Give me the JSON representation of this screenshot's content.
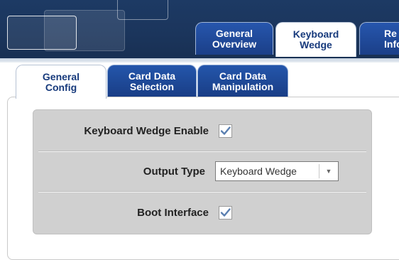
{
  "top_tabs": [
    {
      "label_line1": "General",
      "label_line2": "Overview",
      "active": false
    },
    {
      "label_line1": "Keyboard",
      "label_line2": "Wedge",
      "active": true
    },
    {
      "label_line1": "Re",
      "label_line2": "Infor",
      "active": false
    }
  ],
  "sub_tabs": [
    {
      "label_line1": "General",
      "label_line2": "Config",
      "active": true
    },
    {
      "label_line1": "Card Data",
      "label_line2": "Selection",
      "active": false
    },
    {
      "label_line1": "Card Data",
      "label_line2": "Manipulation",
      "active": false
    }
  ],
  "settings": {
    "keyboard_wedge_enable": {
      "label": "Keyboard Wedge Enable",
      "checked": true
    },
    "output_type": {
      "label": "Output Type",
      "selected": "Keyboard Wedge",
      "arrow_icon": "chevron-down-icon"
    },
    "boot_interface": {
      "label": "Boot Interface",
      "checked": true
    }
  },
  "colors": {
    "banner": "#1b355c",
    "tab_blue": "#1f4a9a",
    "tab_active_text": "#173a7c",
    "panel": "#d0d0d0",
    "check_mark": "#5a7fb0"
  }
}
